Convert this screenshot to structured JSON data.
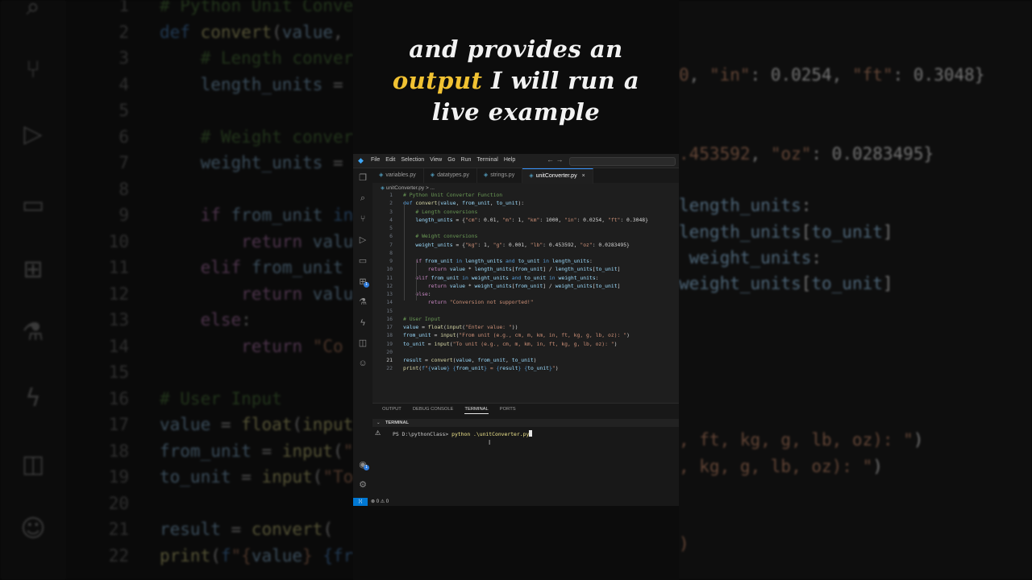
{
  "caption": {
    "line1": "and provides an",
    "highlight": "output",
    "line2_rest": " I will run a",
    "line3": "live example"
  },
  "colors": {
    "caption_highlight": "#f1c232",
    "accent": "#0078d4",
    "keyword": "#569cd6",
    "comment": "#6a9955",
    "string": "#ce9178",
    "function": "#dcdcaa"
  },
  "window": {
    "menu": [
      "File",
      "Edit",
      "Selection",
      "View",
      "Go",
      "Run",
      "Terminal",
      "Help"
    ],
    "nav_arrows": "← →"
  },
  "activity_icons": [
    "explorer-icon",
    "search-icon",
    "source-control-icon",
    "run-debug-icon",
    "remote-explorer-icon",
    "extensions-icon",
    "testing-icon",
    "lightning-icon",
    "database-icon",
    "copilot-icon",
    "account-icon",
    "settings-icon"
  ],
  "activity_badge": "1",
  "tabs": [
    {
      "label": "variables.py",
      "active": false
    },
    {
      "label": "datatypes.py",
      "active": false
    },
    {
      "label": "strings.py",
      "active": false
    },
    {
      "label": "unitConverter.py",
      "active": true
    }
  ],
  "tab_close": "×",
  "breadcrumb": {
    "file": "unitConverter.py",
    "sep": "> ..."
  },
  "editor": {
    "line_numbers": [
      "1",
      "2",
      "3",
      "4",
      "5",
      "6",
      "7",
      "8",
      "9",
      "10",
      "11",
      "12",
      "13",
      "14",
      "15",
      "16",
      "17",
      "18",
      "19",
      "20",
      "21",
      "22"
    ],
    "current_line": "21"
  },
  "panel": {
    "tabs": [
      "OUTPUT",
      "DEBUG CONSOLE",
      "TERMINAL",
      "PORTS"
    ],
    "active_tab": "TERMINAL",
    "terminal_label": "TERMINAL",
    "prompt": "PS D:\\pythonClass> ",
    "command": "python .\\unitConverter.py"
  },
  "status": {
    "errors": "0",
    "warnings": "0"
  }
}
